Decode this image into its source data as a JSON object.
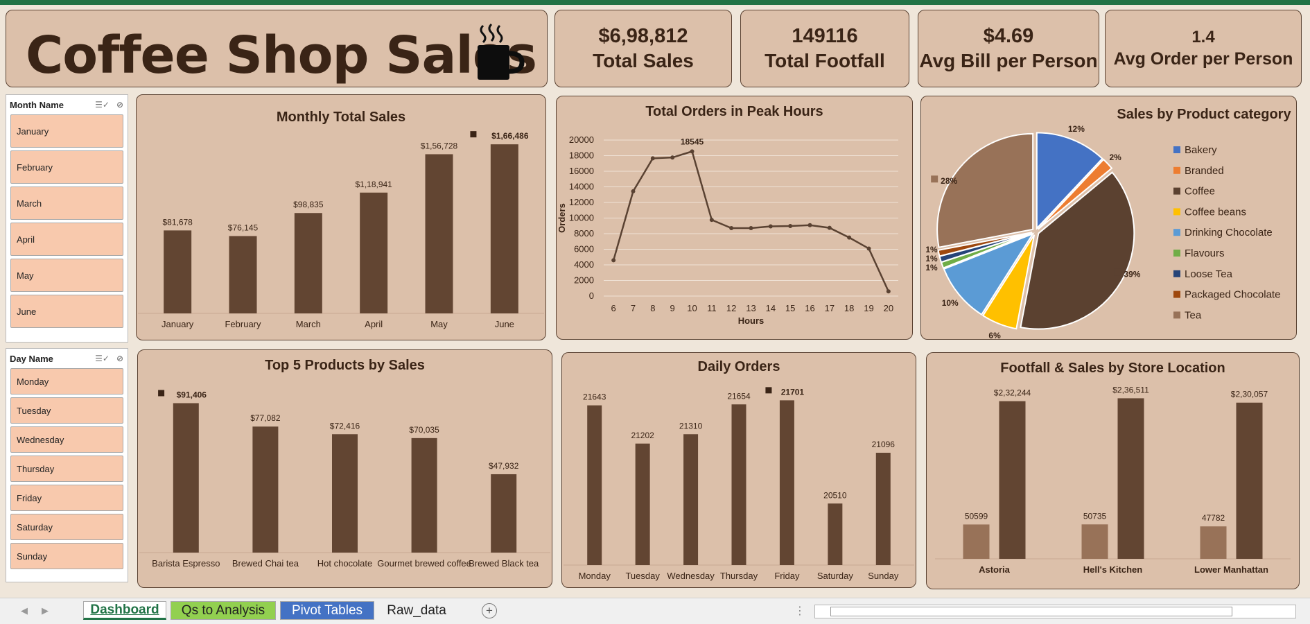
{
  "dashboard": {
    "title": "Coffee Shop Sales",
    "kpis": [
      {
        "value": "$6,98,812",
        "label": "Total Sales"
      },
      {
        "value": "149116",
        "label": "Total Footfall"
      },
      {
        "value": "$4.69",
        "label": "Avg Bill per Person"
      },
      {
        "value": "1.4",
        "label": "Avg Order per Person"
      }
    ]
  },
  "slicers": {
    "month": {
      "header": "Month Name",
      "items": [
        "January",
        "February",
        "March",
        "April",
        "May",
        "June"
      ]
    },
    "day": {
      "header": "Day Name",
      "items": [
        "Monday",
        "Tuesday",
        "Wednesday",
        "Thursday",
        "Friday",
        "Saturday",
        "Sunday"
      ]
    }
  },
  "tabs": {
    "dashboard": "Dashboard",
    "qs": "Qs to Analysis",
    "pivot": "Pivot Tables",
    "raw": "Raw_data"
  },
  "colors": {
    "bar": "#624532",
    "bar_light": "#987258",
    "panel": "#dcc0aa",
    "border": "#5a4232"
  },
  "chart_data": [
    {
      "type": "bar",
      "title": "Monthly Total Sales",
      "categories": [
        "January",
        "February",
        "March",
        "April",
        "May",
        "June"
      ],
      "values": [
        81678,
        76145,
        98835,
        118941,
        156728,
        166486
      ],
      "data_labels": [
        "$81,678",
        "$76,145",
        "$98,835",
        "$1,18,941",
        "$1,56,728",
        "$1,66,486"
      ],
      "ylim": [
        0,
        170000
      ]
    },
    {
      "type": "line",
      "title": "Total Orders in Peak Hours",
      "xlabel": "Hours",
      "ylabel": "Orders",
      "x": [
        6,
        7,
        8,
        9,
        10,
        11,
        12,
        13,
        14,
        15,
        16,
        17,
        18,
        19,
        20
      ],
      "y": [
        4594,
        13428,
        17654,
        17764,
        18545,
        9766,
        8708,
        8714,
        8933,
        8979,
        9093,
        8745,
        7498,
        6092,
        603
      ],
      "peak_label": "18545",
      "ylim": [
        0,
        20000
      ],
      "yticks": [
        0,
        2000,
        4000,
        6000,
        8000,
        10000,
        12000,
        14000,
        16000,
        18000,
        20000
      ],
      "grid": true
    },
    {
      "type": "pie",
      "title": "Sales by Product category",
      "legend_position": "right",
      "labels": [
        "Bakery",
        "Branded",
        "Coffee",
        "Coffee beans",
        "Drinking Chocolate",
        "Flavours",
        "Loose Tea",
        "Packaged Chocolate",
        "Tea"
      ],
      "values": [
        12,
        2,
        39,
        6,
        10,
        1,
        1,
        1,
        28
      ],
      "data_labels": [
        "12%",
        "2%",
        "39%",
        "6%",
        "10%",
        "1%",
        "1%",
        "1%",
        "28%"
      ],
      "colors": [
        "#4472c4",
        "#ed7d31",
        "#5b4130",
        "#ffc000",
        "#5b9bd5",
        "#70ad47",
        "#264478",
        "#9e480e",
        "#987258"
      ]
    },
    {
      "type": "bar",
      "title": "Top 5 Products by Sales",
      "categories": [
        "Barista Espresso",
        "Brewed Chai tea",
        "Hot chocolate",
        "Gourmet brewed coffee",
        "Brewed Black tea"
      ],
      "values": [
        91406,
        77082,
        72416,
        70035,
        47932
      ],
      "data_labels": [
        "$91,406",
        "$77,082",
        "$72,416",
        "$70,035",
        "$47,932"
      ],
      "ylim": [
        0,
        95000
      ]
    },
    {
      "type": "bar",
      "title": "Daily Orders",
      "categories": [
        "Monday",
        "Tuesday",
        "Wednesday",
        "Thursday",
        "Friday",
        "Saturday",
        "Sunday"
      ],
      "values": [
        21643,
        21202,
        21310,
        21654,
        21701,
        20510,
        21096
      ],
      "data_labels": [
        "21643",
        "21202",
        "21310",
        "21654",
        "21701",
        "20510",
        "21096"
      ],
      "ylim": [
        19800,
        21720
      ]
    },
    {
      "type": "bar",
      "title": "Footfall & Sales by Store Location",
      "categories": [
        "Astoria",
        "Hell's Kitchen",
        "Lower Manhattan"
      ],
      "series": [
        {
          "values": [
            50599,
            50735,
            47782
          ],
          "data_labels": [
            "50599",
            "50735",
            "47782"
          ]
        },
        {
          "values": [
            232244,
            236511,
            230057
          ],
          "data_labels": [
            "$2,32,244",
            "$2,36,511",
            "$2,30,057"
          ]
        }
      ],
      "ylim": [
        0,
        240000
      ]
    }
  ]
}
